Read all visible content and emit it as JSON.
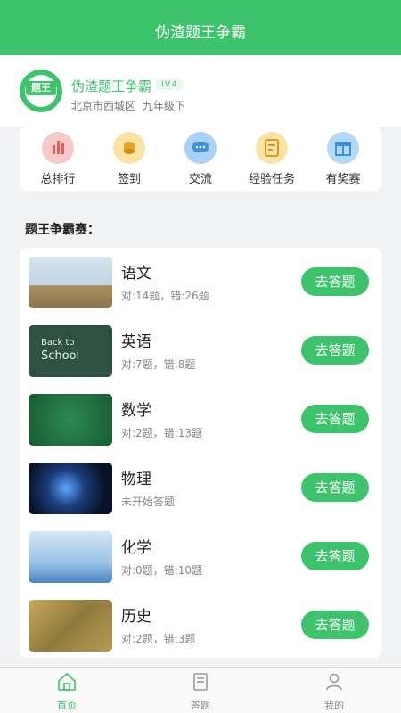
{
  "header": {
    "title": "伪渣题王争霸"
  },
  "profile": {
    "avatar_text": "题王",
    "name": "伪渣题王争霸",
    "level": "LV.4",
    "location": "北京市西城区",
    "grade": "九年级下"
  },
  "menu": [
    {
      "label": "总排行",
      "icon": "bar-chart-icon",
      "color": "#f08b8b"
    },
    {
      "label": "签到",
      "icon": "coin-icon",
      "color": "#f5c64d"
    },
    {
      "label": "交流",
      "icon": "chat-icon",
      "color": "#5aa9f0"
    },
    {
      "label": "经验任务",
      "icon": "task-icon",
      "color": "#f5c64d"
    },
    {
      "label": "有奖赛",
      "icon": "gift-icon",
      "color": "#6ab4f2"
    }
  ],
  "section_title": "题王争霸赛：",
  "subjects": [
    {
      "name": "语文",
      "stats": "对:14题，错:26题",
      "button": "去答题",
      "thumb_colors": [
        "#c8d9e6",
        "#b49a6c"
      ]
    },
    {
      "name": "英语",
      "stats": "对:7题，错:8题",
      "button": "去答题",
      "thumb_colors": [
        "#2f5141",
        "#d8e4dc"
      ]
    },
    {
      "name": "数学",
      "stats": "对:2题，错:13题",
      "button": "去答题",
      "thumb_colors": [
        "#1f6b3d",
        "#c9e6cf"
      ]
    },
    {
      "name": "物理",
      "stats": "未开始答题",
      "button": "去答题",
      "thumb_colors": [
        "#0a1530",
        "#3b7fd1"
      ]
    },
    {
      "name": "化学",
      "stats": "对:0题，错:10题",
      "button": "去答题",
      "thumb_colors": [
        "#b8d6ee",
        "#4b8ccc"
      ]
    },
    {
      "name": "历史",
      "stats": "对:2题，错:3题",
      "button": "去答题",
      "thumb_colors": [
        "#b99a4a",
        "#6f6a3a"
      ]
    }
  ],
  "tabs": [
    {
      "label": "首页",
      "icon": "home-icon",
      "active": true
    },
    {
      "label": "答题",
      "icon": "answer-icon",
      "active": false
    },
    {
      "label": "我的",
      "icon": "user-icon",
      "active": false
    }
  ],
  "colors": {
    "brand": "#3cc36b"
  }
}
